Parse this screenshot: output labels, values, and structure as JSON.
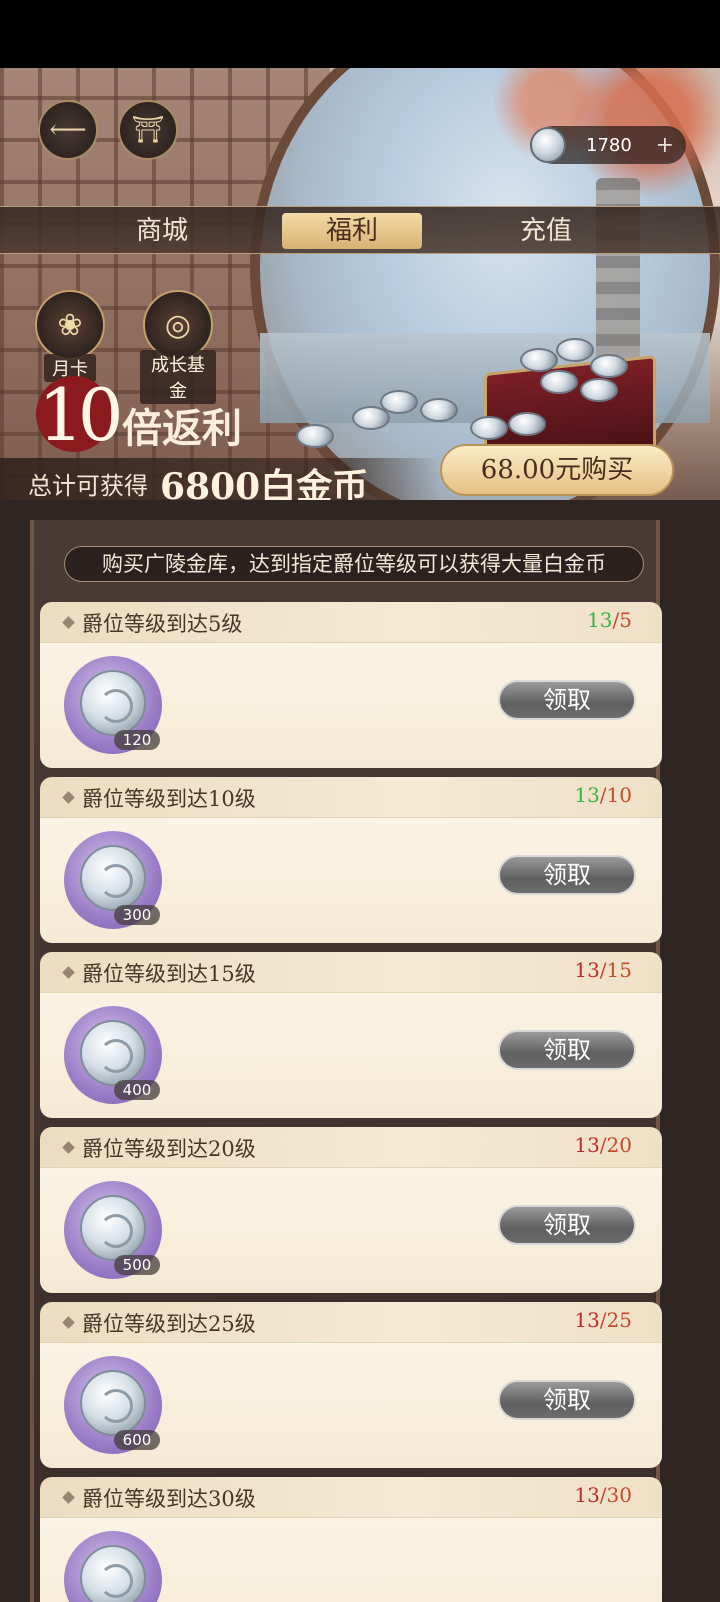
{
  "header": {
    "currency_value": "1780",
    "currency_plus": "+"
  },
  "tabs": [
    {
      "label": "商城"
    },
    {
      "label": "福利",
      "active": true
    },
    {
      "label": "充值"
    }
  ],
  "side_icons": {
    "month_card": "月卡",
    "growth_fund": "成长基金"
  },
  "promo": {
    "multiplier": "10",
    "rebate": "倍返利",
    "total_label": "总计可获得",
    "total_value": "6800白金币",
    "buy_label": "68.00元购买"
  },
  "notice": "购买广陵金库，达到指定爵位等级可以获得大量白金币",
  "tasks": [
    {
      "title": "爵位等级到达5级",
      "current": "13",
      "sep": "/",
      "required": "5",
      "reward": "120",
      "button": "领取"
    },
    {
      "title": "爵位等级到达10级",
      "current": "13",
      "sep": "/",
      "required": "10",
      "reward": "300",
      "button": "领取"
    },
    {
      "title": "爵位等级到达15级",
      "current": "13",
      "sep": "/",
      "required": "15",
      "reward": "400",
      "button": "领取"
    },
    {
      "title": "爵位等级到达20级",
      "current": "13",
      "sep": "/",
      "required": "20",
      "reward": "500",
      "button": "领取"
    },
    {
      "title": "爵位等级到达25级",
      "current": "13",
      "sep": "/",
      "required": "25",
      "reward": "600",
      "button": "领取"
    },
    {
      "title": "爵位等级到达30级",
      "current": "13",
      "sep": "/",
      "required": "30",
      "reward": "",
      "button": ""
    }
  ],
  "colors": {
    "progress_met": "#36b540",
    "progress_unmet": "#c2272a",
    "tab_active": "#e5c58c"
  }
}
